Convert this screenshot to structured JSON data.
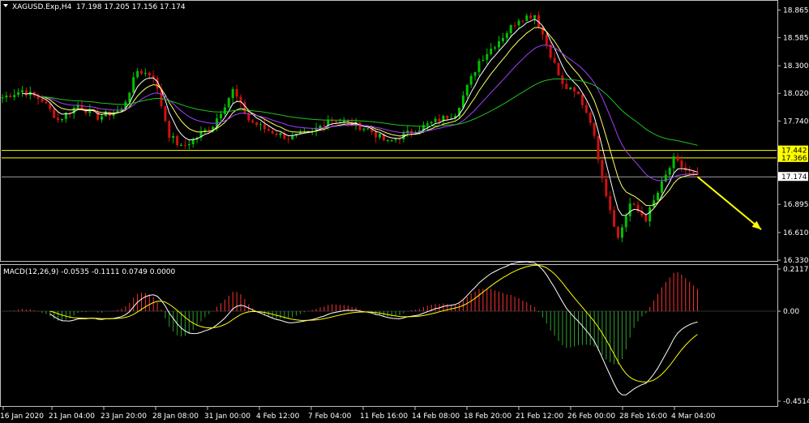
{
  "header": {
    "symbol": "XAGUSD.Exp,H4",
    "ohlc": "17.198 17.205 17.156 17.174"
  },
  "macd_header": {
    "label": "MACD(12,26,9) -0.0535 -0.1111 0.0749 0.0000"
  },
  "colors": {
    "background": "#000000",
    "frame": "#c0c0c0",
    "bull_candle": "#00c000",
    "bear_candle": "#d01010",
    "ma_fast": "#ffffff",
    "ma_mid": "#ffff66",
    "ma_slow": "#a040ff",
    "ma_long": "#20c020",
    "level_line": "#ffff00",
    "bid_line": "#a0a0a0",
    "arrow": "#ffff00",
    "macd_line": "#ffffff",
    "signal_line": "#ffff00",
    "hist_pos": "#ff3030",
    "hist_neg": "#30a030"
  },
  "chart_data": [
    {
      "type": "candlestick",
      "title": "XAGUSD.Exp,H4",
      "y_ticks": [
        "18.865",
        "18.585",
        "18.300",
        "18.020",
        "17.740",
        "17.174",
        "16.895",
        "16.610",
        "16.330"
      ],
      "ylim": [
        16.33,
        18.95
      ],
      "x_ticks": [
        "16 Jan 2020",
        "21 Jan 04:00",
        "23 Jan 20:00",
        "28 Jan 08:00",
        "31 Jan 00:00",
        "4 Feb 12:00",
        "7 Feb 04:00",
        "11 Feb 16:00",
        "14 Feb 08:00",
        "18 Feb 20:00",
        "21 Feb 12:00",
        "26 Feb 00:00",
        "28 Feb 16:00",
        "4 Mar 04:00"
      ],
      "levels": [
        {
          "value": 17.442,
          "label": "17.442"
        },
        {
          "value": 17.366,
          "label": "17.366"
        }
      ],
      "current_price": {
        "value": 17.174,
        "label": "17.174"
      },
      "price_path": [
        [
          0,
          17.98
        ],
        [
          5,
          18.05
        ],
        [
          10,
          17.95
        ],
        [
          14,
          17.75
        ],
        [
          19,
          17.9
        ],
        [
          24,
          17.78
        ],
        [
          30,
          17.85
        ],
        [
          34,
          18.25
        ],
        [
          38,
          18.2
        ],
        [
          42,
          17.6
        ],
        [
          45,
          17.47
        ],
        [
          48,
          17.55
        ],
        [
          53,
          17.7
        ],
        [
          58,
          18.05
        ],
        [
          62,
          17.75
        ],
        [
          66,
          17.66
        ],
        [
          72,
          17.57
        ],
        [
          78,
          17.62
        ],
        [
          82,
          17.76
        ],
        [
          87,
          17.72
        ],
        [
          92,
          17.66
        ],
        [
          97,
          17.52
        ],
        [
          100,
          17.58
        ],
        [
          108,
          17.72
        ],
        [
          114,
          17.82
        ],
        [
          120,
          18.35
        ],
        [
          126,
          18.6
        ],
        [
          130,
          18.78
        ],
        [
          134,
          18.82
        ],
        [
          137,
          18.52
        ],
        [
          141,
          18.1
        ],
        [
          145,
          18.0
        ],
        [
          148,
          17.75
        ],
        [
          152,
          17.0
        ],
        [
          155,
          16.55
        ],
        [
          158,
          16.9
        ],
        [
          162,
          16.75
        ],
        [
          166,
          17.1
        ],
        [
          169,
          17.35
        ],
        [
          172,
          17.24
        ],
        [
          175,
          17.17
        ]
      ],
      "candles_total": 176,
      "moving_averages": [
        {
          "name": "",
          "color": "#ffffff",
          "period": 5
        },
        {
          "name": "",
          "color": "#ffff66",
          "period": 10
        },
        {
          "name": "",
          "color": "#a040ff",
          "period": 21
        },
        {
          "name": "",
          "color": "#20c020",
          "period": 60
        }
      ],
      "arrow": {
        "from": [
          175,
          17.174
        ],
        "to": [
          190,
          16.64
        ]
      }
    },
    {
      "type": "macd",
      "title": "MACD(12,26,9) -0.0535 -0.1111 0.0749 0.0000",
      "y_ticks": [
        "0.2117",
        "0.00",
        "-0.4514"
      ],
      "ylim": [
        -0.4514,
        0.2117
      ],
      "macd": -0.0535,
      "signal": -0.1111,
      "histogram": 0.0749
    }
  ]
}
